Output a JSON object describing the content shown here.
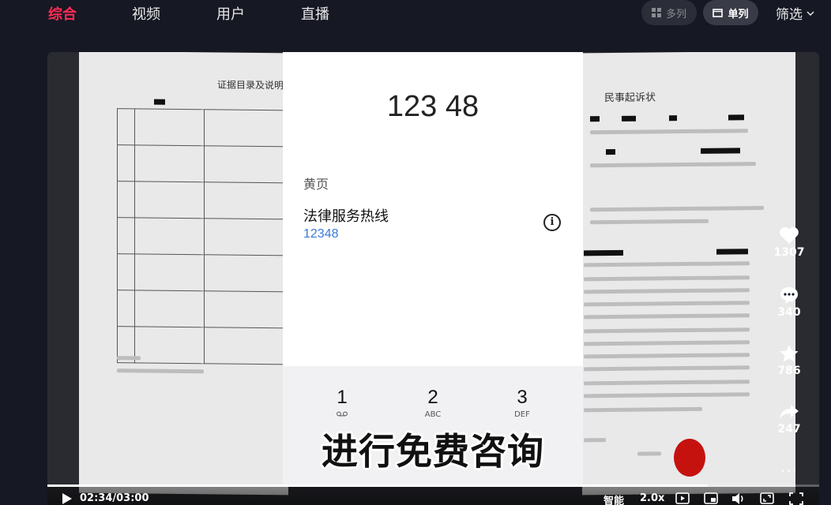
{
  "nav": {
    "tabs": [
      {
        "label": "综合",
        "active": true
      },
      {
        "label": "视频",
        "active": false
      },
      {
        "label": "用户",
        "active": false
      },
      {
        "label": "直播",
        "active": false
      }
    ],
    "view_modes": [
      {
        "label": "多列",
        "icon": "grid-icon",
        "active": false
      },
      {
        "label": "单列",
        "icon": "single-column-icon",
        "active": true
      }
    ],
    "filter_label": "筛选"
  },
  "video": {
    "left_doc_title": "证据目录及说明",
    "right_doc_title": "民事起诉状",
    "phone": {
      "dialed_number": "123 48",
      "section_label": "黄页",
      "contact_name": "法律服务热线",
      "contact_number": "12348",
      "keys": [
        {
          "digit": "1",
          "letters": "voicemail-icon"
        },
        {
          "digit": "2",
          "letters": "ABC"
        },
        {
          "digit": "3",
          "letters": "DEF"
        }
      ]
    },
    "caption": "进行免费咨询",
    "accent_color": "#fe2c55"
  },
  "actions": {
    "likes": "1307",
    "comments": "340",
    "favorites": "786",
    "shares": "247",
    "more_label": "···"
  },
  "player": {
    "time": "02:34/03:00",
    "progress": 0.856,
    "smart_label": "智能",
    "speed_label": "2.0x"
  }
}
